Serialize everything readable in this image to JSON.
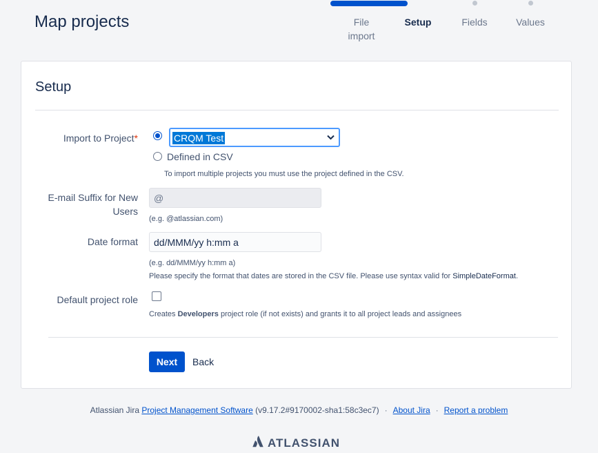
{
  "page": {
    "title": "Map projects"
  },
  "steps": [
    {
      "label": "File import",
      "state": "done"
    },
    {
      "label": "Setup",
      "state": "current"
    },
    {
      "label": "Fields",
      "state": "todo"
    },
    {
      "label": "Values",
      "state": "todo"
    }
  ],
  "setup": {
    "title": "Setup",
    "import_project": {
      "label": "Import to Project",
      "required_mark": "*",
      "selected_value": "CRQM Test",
      "option_csv": "Defined in CSV",
      "help": "To import multiple projects you must use the project defined in the CSV."
    },
    "email_suffix": {
      "label": "E-mail Suffix for New Users",
      "value": "@",
      "help": "(e.g. @atlassian.com)"
    },
    "date_format": {
      "label": "Date format",
      "value": "dd/MMM/yy h:mm a",
      "help_example": "(e.g. dd/MMM/yy h:mm a)",
      "help_text": "Please specify the format that dates are stored in the CSV file. Please use syntax valid for ",
      "help_link": "SimpleDateFormat",
      "help_end": "."
    },
    "default_role": {
      "label": "Default project role",
      "checked": false,
      "help_prefix": "Creates ",
      "help_bold": "Developers",
      "help_suffix": " project role (if not exists) and grants it to all project leads and assignees"
    },
    "buttons": {
      "next": "Next",
      "back": "Back"
    }
  },
  "footer": {
    "prefix": "Atlassian Jira ",
    "pms_link": "Project Management Software",
    "version": " (v9.17.2#9170002-sha1:58c3ec7)",
    "separator": "·",
    "about": "About Jira",
    "report": "Report a problem",
    "logo": "ATLASSIAN"
  },
  "colors": {
    "brand": "#0052cc",
    "focus": "#4c9aff",
    "selection": "#0078d7"
  }
}
